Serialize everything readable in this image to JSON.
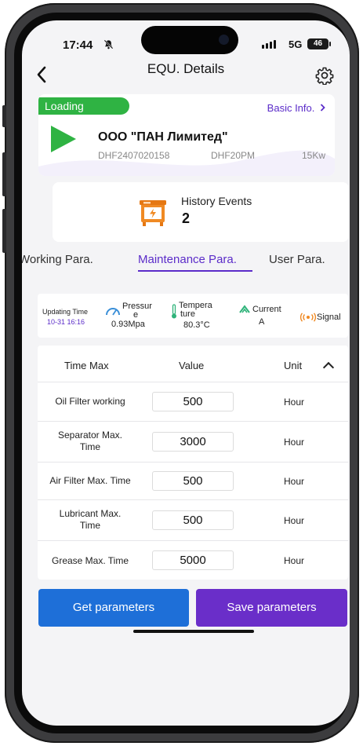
{
  "status_bar": {
    "time": "17:44",
    "network": "5G",
    "battery": "46"
  },
  "nav": {
    "title": "EQU. Details"
  },
  "device": {
    "status": "Loading",
    "status_color": "#2fb343",
    "basic_info_link": "Basic Info.",
    "company": "ООО \"ПАН Лимитед\"",
    "serial": "DHF2407020158",
    "model": "DHF20PM",
    "power": "15Kw"
  },
  "history": {
    "label": "History Events",
    "count": "2",
    "icon": "controller-box-icon"
  },
  "tabs": [
    {
      "label": "Working Para.",
      "active": false
    },
    {
      "label": "Maintenance Para.",
      "active": true
    },
    {
      "label": "User Para.",
      "active": false
    }
  ],
  "sensors": {
    "updating_time_label": "Updating Time",
    "updating_time_value": "10-31 16:16",
    "pressure_label_1": "Pressur",
    "pressure_label_2": "e",
    "pressure_value": "0.93Mpa",
    "temperature_label_1": "Tempera",
    "temperature_label_2": "ture",
    "temperature_value": "80.3°C",
    "current_label": "Current",
    "current_value": "A",
    "signal_label": "Signal"
  },
  "params_table": {
    "headers": {
      "name": "Time Max",
      "value": "Value",
      "unit": "Unit"
    },
    "rows": [
      {
        "name": "Oil Filter working",
        "value": "500",
        "unit": "Hour"
      },
      {
        "name_line1": "Separator Max.",
        "name_line2": "Time",
        "value": "3000",
        "unit": "Hour"
      },
      {
        "name": "Air Filter Max. Time",
        "value": "500",
        "unit": "Hour"
      },
      {
        "name_line1": "Lubricant Max.",
        "name_line2": "Time",
        "value": "500",
        "unit": "Hour"
      },
      {
        "name": "Grease Max. Time",
        "value": "5000",
        "unit": "Hour"
      }
    ]
  },
  "actions": {
    "get": "Get parameters",
    "save": "Save parameters"
  },
  "colors": {
    "accent": "#5b2cc9",
    "get_button": "#1e6fd8",
    "save_button": "#6a2ec9",
    "status_green": "#2fb343"
  }
}
